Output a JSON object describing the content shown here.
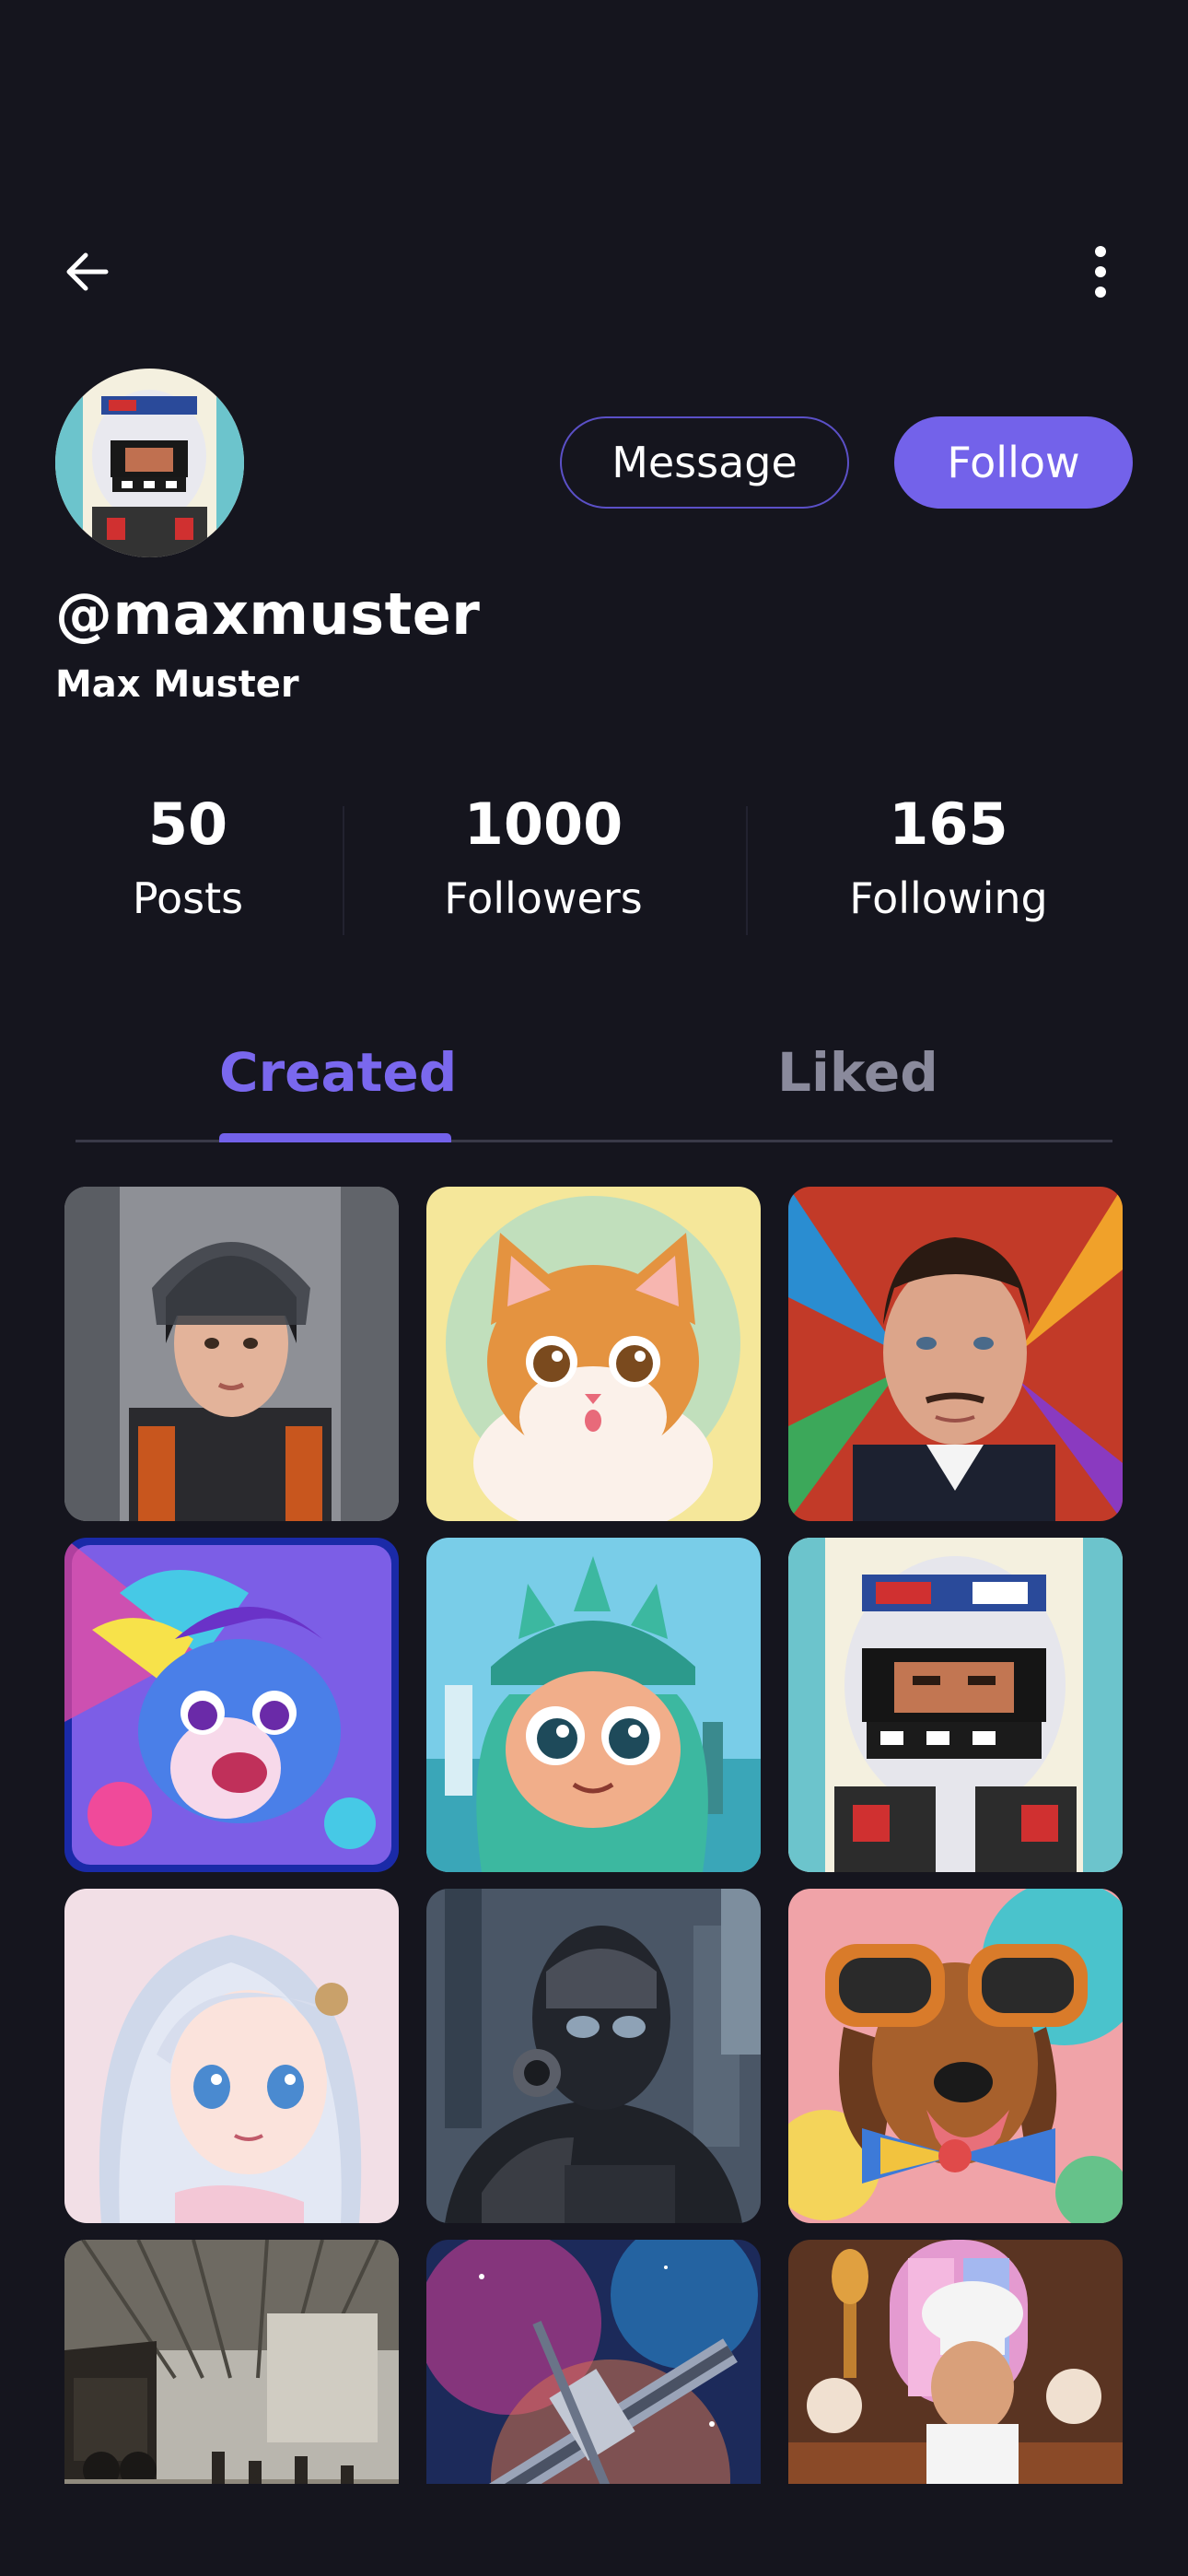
{
  "nav": {
    "back_icon": "arrow-left-icon",
    "more_icon": "more-vertical-icon"
  },
  "profile": {
    "username": "@maxmuster",
    "display_name": "Max Muster",
    "message_label": "Message",
    "follow_label": "Follow"
  },
  "stats": [
    {
      "value": "50",
      "label": "Posts"
    },
    {
      "value": "1000",
      "label": "Followers"
    },
    {
      "value": "165",
      "label": "Following"
    }
  ],
  "tabs": [
    {
      "label": "Created",
      "active": true
    },
    {
      "label": "Liked",
      "active": false
    }
  ],
  "colors": {
    "background": "#15151e",
    "accent": "#7362ea",
    "inactive_tab": "#8a8a9c"
  },
  "grid_items": [
    "woman-astronaut-image",
    "cat-image",
    "man-portrait-image",
    "dragon-image",
    "statue-of-liberty-image",
    "pixel-racer-image",
    "anime-girl-image",
    "robot-image",
    "dog-sunglasses-image",
    "train-station-image",
    "space-station-image",
    "chef-image"
  ]
}
